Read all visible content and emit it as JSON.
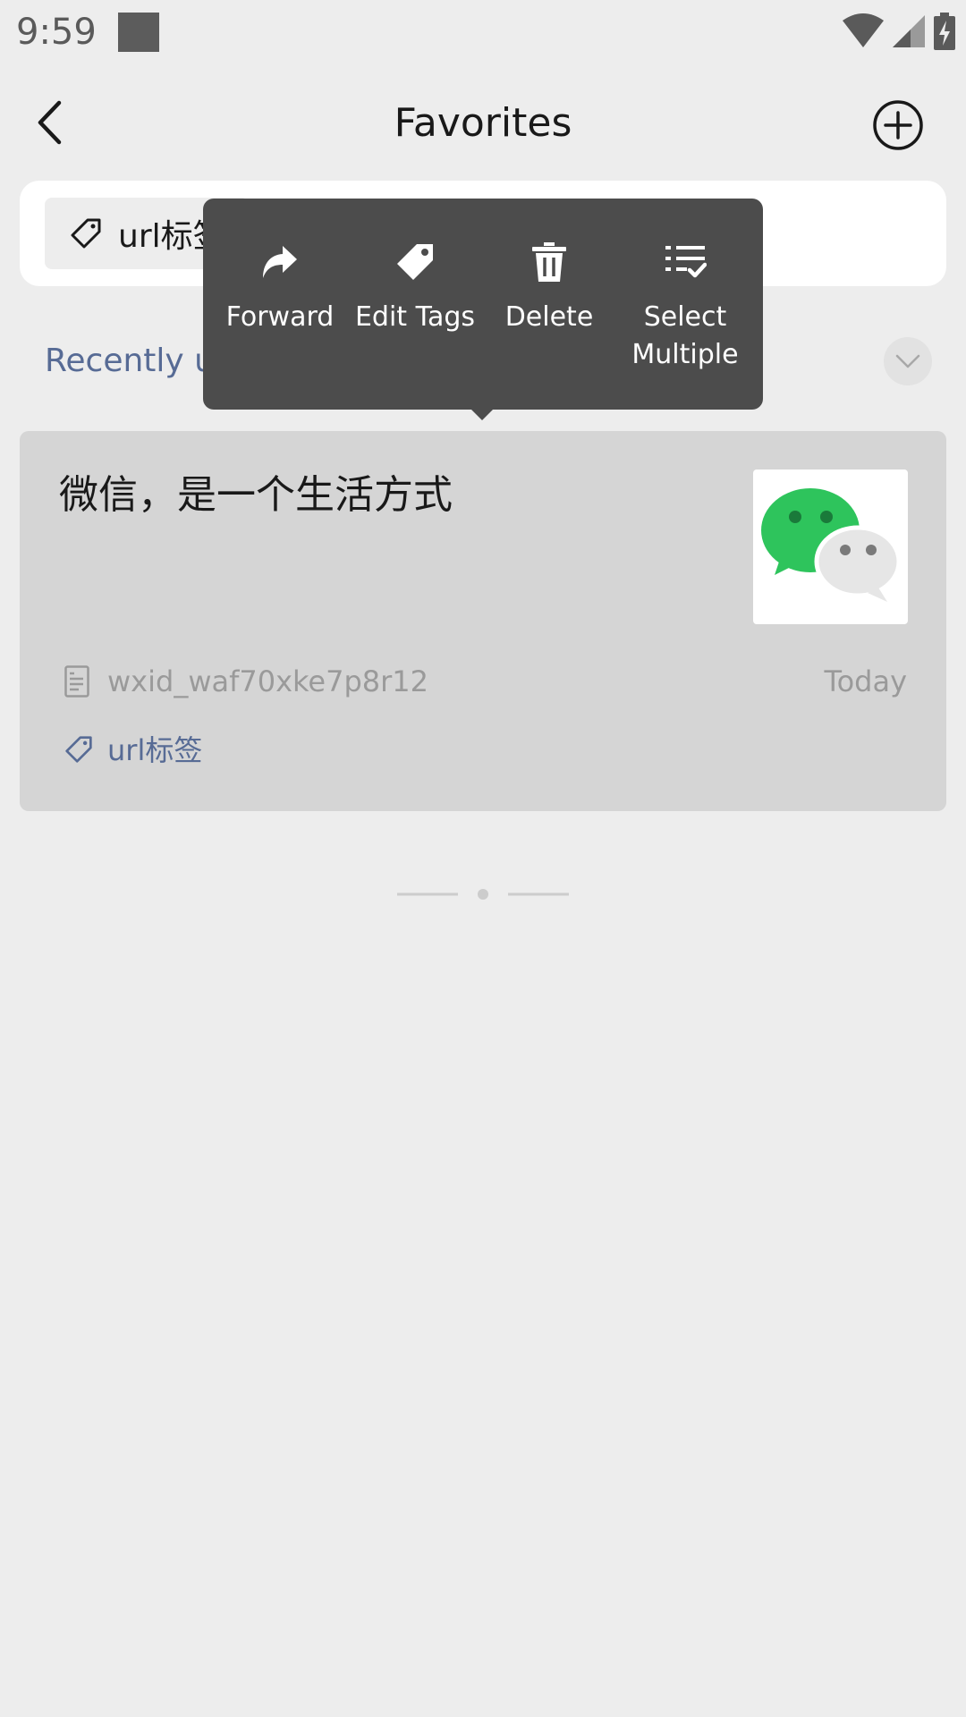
{
  "status_bar": {
    "time": "9:59"
  },
  "header": {
    "title": "Favorites"
  },
  "tag_bar": {
    "tag_label": "url标签"
  },
  "recent": {
    "label": "Recently used"
  },
  "card": {
    "title": "微信，是一个生活方式",
    "source": "wxid_waf70xke7p8r12",
    "date": "Today",
    "tag": "url标签"
  },
  "context_menu": {
    "items": [
      {
        "label": "Forward",
        "icon": "forward-icon"
      },
      {
        "label": "Edit Tags",
        "icon": "tag-icon"
      },
      {
        "label": "Delete",
        "icon": "trash-icon"
      },
      {
        "label": "Select\nMultiple",
        "icon": "select-multiple-icon"
      }
    ]
  },
  "colors": {
    "link": "#576b95",
    "menu_bg": "#4c4c4c",
    "wechat_green": "#2ec45c"
  }
}
